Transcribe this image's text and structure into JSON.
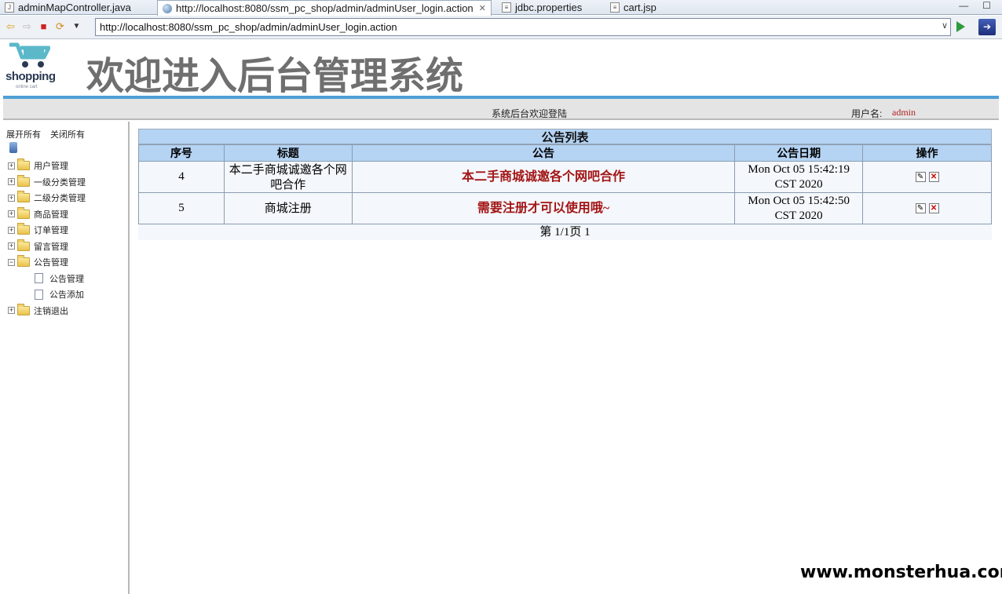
{
  "editor_tabs": [
    {
      "label": "adminMapController.java",
      "icon": "java-file-icon"
    },
    {
      "label": "http://localhost:8080/ssm_pc_shop/admin/adminUser_login.action",
      "icon": "globe-icon",
      "active": true
    },
    {
      "label": "jdbc.properties",
      "icon": "properties-file-icon"
    },
    {
      "label": "cart.jsp",
      "icon": "jsp-file-icon"
    }
  ],
  "browser": {
    "url": "http://localhost:8080/ssm_pc_shop/admin/adminUser_login.action"
  },
  "header": {
    "logo_text": "shopping",
    "logo_sub": "online cart",
    "title": "欢迎进入后台管理系统",
    "welcome": "系统后台欢迎登陆",
    "user_label": "用户名:",
    "username": "admin"
  },
  "sidebar": {
    "expand_all": "展开所有",
    "collapse_all": "关闭所有",
    "items": [
      {
        "label": "用户管理"
      },
      {
        "label": "一级分类管理"
      },
      {
        "label": "二级分类管理"
      },
      {
        "label": "商品管理"
      },
      {
        "label": "订单管理"
      },
      {
        "label": "留言管理"
      },
      {
        "label": "公告管理",
        "expanded": true,
        "children": [
          {
            "label": "公告管理"
          },
          {
            "label": "公告添加"
          }
        ]
      },
      {
        "label": "注销退出"
      }
    ]
  },
  "notice_table": {
    "caption": "公告列表",
    "headers": [
      "序号",
      "标题",
      "公告",
      "公告日期",
      "操作"
    ],
    "rows": [
      {
        "id": "4",
        "title": "本二手商城诚邀各个网吧合作",
        "content": "本二手商城诚邀各个网吧合作",
        "date": "Mon Oct 05 15:42:19 CST 2020"
      },
      {
        "id": "5",
        "title": "商城注册",
        "content": "需要注册才可以使用哦~",
        "date": "Mon Oct 05 15:42:50 CST 2020"
      }
    ],
    "pager": "第 1/1页 1"
  },
  "watermark": "www.monsterhua.com",
  "colors": {
    "header_blue": "#b5d3f3",
    "accent_bar": "#4f9fd6",
    "notice_red": "#a31515",
    "username_red": "#b22222"
  }
}
